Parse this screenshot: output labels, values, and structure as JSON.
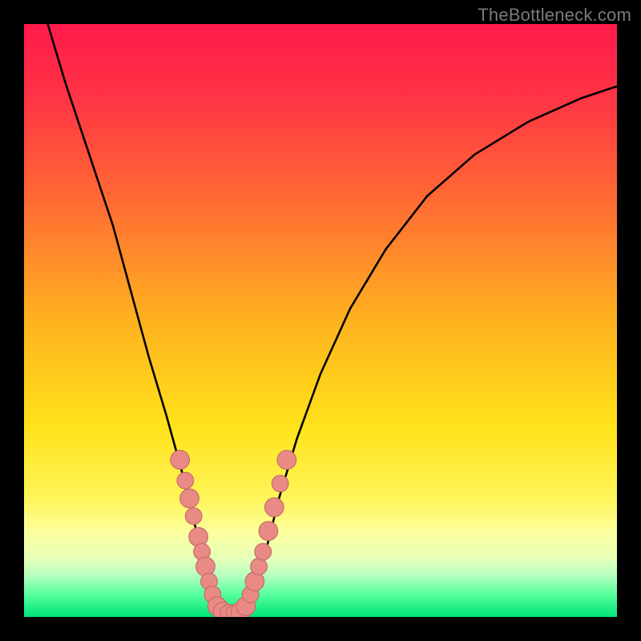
{
  "watermark": {
    "text": "TheBottleneck.com"
  },
  "colors": {
    "frame": "#000000",
    "watermark": "#7a7a7a",
    "curve": "#000000",
    "marker_fill": "#e98a86",
    "marker_stroke": "#c46a66",
    "gradient_stops": [
      {
        "offset": 0.0,
        "color": "#ff1a4b"
      },
      {
        "offset": 0.12,
        "color": "#ff3345"
      },
      {
        "offset": 0.3,
        "color": "#ff6b33"
      },
      {
        "offset": 0.5,
        "color": "#ffb21f"
      },
      {
        "offset": 0.68,
        "color": "#ffe21a"
      },
      {
        "offset": 0.8,
        "color": "#fff55a"
      },
      {
        "offset": 0.86,
        "color": "#fbffa0"
      },
      {
        "offset": 0.9,
        "color": "#e7ffb8"
      },
      {
        "offset": 0.93,
        "color": "#b7ffc0"
      },
      {
        "offset": 0.96,
        "color": "#5cff9e"
      },
      {
        "offset": 1.0,
        "color": "#00e57a"
      }
    ]
  },
  "chart_data": {
    "type": "line",
    "title": "",
    "xlabel": "",
    "ylabel": "",
    "xlim": [
      0,
      100
    ],
    "ylim": [
      0,
      100
    ],
    "curve": {
      "left": [
        {
          "x": 4,
          "y": 100
        },
        {
          "x": 7,
          "y": 90
        },
        {
          "x": 11,
          "y": 78
        },
        {
          "x": 15,
          "y": 66
        },
        {
          "x": 18,
          "y": 55
        },
        {
          "x": 21,
          "y": 44
        },
        {
          "x": 24,
          "y": 34
        },
        {
          "x": 26.5,
          "y": 25
        },
        {
          "x": 28.5,
          "y": 17
        },
        {
          "x": 30,
          "y": 10
        },
        {
          "x": 31.2,
          "y": 5
        },
        {
          "x": 32.3,
          "y": 1.2
        }
      ],
      "floor": [
        {
          "x": 32.3,
          "y": 1.2
        },
        {
          "x": 34,
          "y": 0.6
        },
        {
          "x": 36,
          "y": 0.6
        },
        {
          "x": 37.7,
          "y": 1.2
        }
      ],
      "right": [
        {
          "x": 37.7,
          "y": 1.2
        },
        {
          "x": 39,
          "y": 5
        },
        {
          "x": 41,
          "y": 12
        },
        {
          "x": 43,
          "y": 20
        },
        {
          "x": 46,
          "y": 30
        },
        {
          "x": 50,
          "y": 41
        },
        {
          "x": 55,
          "y": 52
        },
        {
          "x": 61,
          "y": 62
        },
        {
          "x": 68,
          "y": 71
        },
        {
          "x": 76,
          "y": 78
        },
        {
          "x": 85,
          "y": 83.5
        },
        {
          "x": 94,
          "y": 87.5
        },
        {
          "x": 100,
          "y": 89.5
        }
      ]
    },
    "series": [
      {
        "name": "markers",
        "points": [
          {
            "x": 26.3,
            "y": 26.5,
            "r": 1.6
          },
          {
            "x": 27.2,
            "y": 23.0,
            "r": 1.4
          },
          {
            "x": 27.9,
            "y": 20.0,
            "r": 1.6
          },
          {
            "x": 28.6,
            "y": 17.0,
            "r": 1.4
          },
          {
            "x": 29.4,
            "y": 13.5,
            "r": 1.6
          },
          {
            "x": 30.0,
            "y": 11.0,
            "r": 1.4
          },
          {
            "x": 30.6,
            "y": 8.5,
            "r": 1.6
          },
          {
            "x": 31.2,
            "y": 6.0,
            "r": 1.4
          },
          {
            "x": 31.8,
            "y": 3.8,
            "r": 1.4
          },
          {
            "x": 32.6,
            "y": 1.8,
            "r": 1.6
          },
          {
            "x": 33.5,
            "y": 0.9,
            "r": 1.6
          },
          {
            "x": 34.5,
            "y": 0.7,
            "r": 1.4
          },
          {
            "x": 35.5,
            "y": 0.7,
            "r": 1.4
          },
          {
            "x": 36.5,
            "y": 0.9,
            "r": 1.6
          },
          {
            "x": 37.4,
            "y": 1.8,
            "r": 1.6
          },
          {
            "x": 38.2,
            "y": 3.8,
            "r": 1.4
          },
          {
            "x": 38.9,
            "y": 6.0,
            "r": 1.6
          },
          {
            "x": 39.6,
            "y": 8.5,
            "r": 1.4
          },
          {
            "x": 40.3,
            "y": 11.0,
            "r": 1.4
          },
          {
            "x": 41.2,
            "y": 14.5,
            "r": 1.6
          },
          {
            "x": 42.2,
            "y": 18.5,
            "r": 1.6
          },
          {
            "x": 43.2,
            "y": 22.5,
            "r": 1.4
          },
          {
            "x": 44.3,
            "y": 26.5,
            "r": 1.6
          }
        ]
      }
    ]
  }
}
